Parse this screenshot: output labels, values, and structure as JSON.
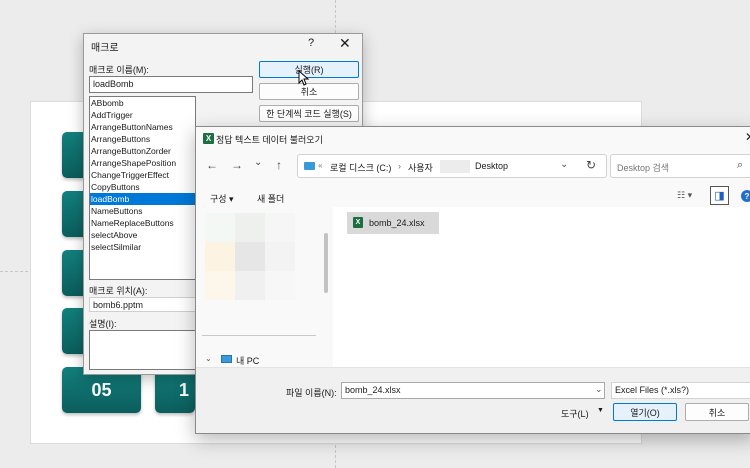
{
  "slide": {
    "tiles": [
      "05",
      "1"
    ]
  },
  "macro_dialog": {
    "title": "매크로",
    "help": "?",
    "close": "✕",
    "name_label": "매크로 이름(M):",
    "name_value": "loadBomb",
    "macros": [
      "ABbomb",
      "AddTrigger",
      "ArrangeButtonNames",
      "ArrangeButtons",
      "ArrangeButtonZorder",
      "ArrangeShapePosition",
      "ChangeTriggerEffect",
      "CopyButtons",
      "loadBomb",
      "NameButtons",
      "NameReplaceButtons",
      "selectAbove",
      "selectSilmilar"
    ],
    "selected_macro": "loadBomb",
    "run": "실행(R)",
    "cancel": "취소",
    "step": "한 단계씩 코드 실행(S)",
    "location_label": "매크로 위치(A):",
    "location_value": "bomb6.pptm",
    "desc_label": "설명(I):"
  },
  "file_dialog": {
    "icon": "X",
    "title": "정답 텍스트 데이터 불러오기",
    "close": "✕",
    "back": "←",
    "forward": "→",
    "dropdown": "⌄",
    "up": "↑",
    "path_sep1": "«",
    "crumb1": "로컬 디스크 (C:)",
    "sep": "›",
    "crumb2": "사용자",
    "crumb3": "Desktop",
    "crumb_dropdown": "⌄",
    "refresh": "↻",
    "search_placeholder": "Desktop 검색",
    "search_icon": "⌕",
    "organize": "구성 ▾",
    "new_folder": "새 폴더",
    "view_icon": "☷ ▾",
    "pane_icon": "◨",
    "help_icon": "?",
    "this_pc": "내 PC",
    "file_item": "bomb_24.xlsx",
    "filename_label": "파일 이름(N):",
    "filename_value": "bomb_24.xlsx",
    "filetype_value": "Excel Files (*.xls?)",
    "tools": "도구(L)",
    "tools_arrow": "▼",
    "open": "열기(O)",
    "cancel": "취소"
  }
}
